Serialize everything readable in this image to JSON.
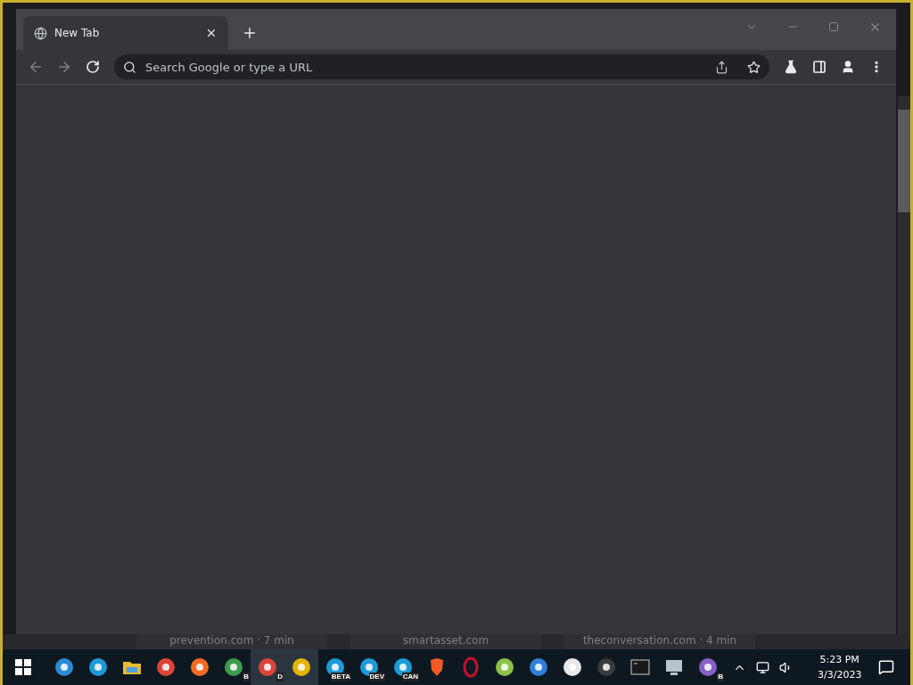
{
  "browser": {
    "tabs": [
      {
        "title": "New Tab",
        "selected": true
      }
    ],
    "omnibox": {
      "placeholder": "Search Google or type a URL"
    }
  },
  "background_page": {
    "articles": [
      "prevention.com · 7 min",
      "smartasset.com",
      "theconversation.com · 4 min"
    ]
  },
  "taskbar": {
    "apps": [
      {
        "kind": "logo",
        "color": "#2a8ad6",
        "selected": false
      },
      {
        "kind": "logo",
        "color": "#1c9bd8",
        "selected": false
      },
      {
        "kind": "folder",
        "color": "#e8b830",
        "selected": false
      },
      {
        "kind": "logo",
        "color": "#db4437",
        "selected": false
      },
      {
        "kind": "logo",
        "color": "#f36b21",
        "selected": false
      },
      {
        "kind": "logo",
        "color": "#3c9b4c",
        "badge": "B",
        "selected": false
      },
      {
        "kind": "logo",
        "color": "#db4437",
        "badge": "D",
        "selected": true
      },
      {
        "kind": "logo",
        "color": "#e6b400",
        "selected": true
      },
      {
        "kind": "logo",
        "color": "#1c9bd8",
        "badge": "BETA",
        "selected": false
      },
      {
        "kind": "logo",
        "color": "#1c9bd8",
        "badge": "DEV",
        "selected": false
      },
      {
        "kind": "logo",
        "color": "#1c9bd8",
        "badge": "CAN",
        "selected": false
      },
      {
        "kind": "shield",
        "color": "#f15a24",
        "selected": false
      },
      {
        "kind": "ring",
        "color": "#c8102e",
        "selected": false
      },
      {
        "kind": "logo",
        "color": "#8bc34a",
        "selected": false
      },
      {
        "kind": "logo",
        "color": "#2f7fd8",
        "selected": false
      },
      {
        "kind": "logo",
        "color": "#e8e8e8",
        "selected": false
      },
      {
        "kind": "logo",
        "color": "#3a3a3a",
        "selected": false
      },
      {
        "kind": "terminal",
        "color": "#1a1a1a",
        "selected": false
      },
      {
        "kind": "monitor",
        "color": "#b8c4cc",
        "selected": false
      },
      {
        "kind": "logo",
        "color": "#8661c5",
        "badge": "B",
        "selected": false
      }
    ],
    "time": "5:23 PM",
    "date": "3/3/2023"
  }
}
